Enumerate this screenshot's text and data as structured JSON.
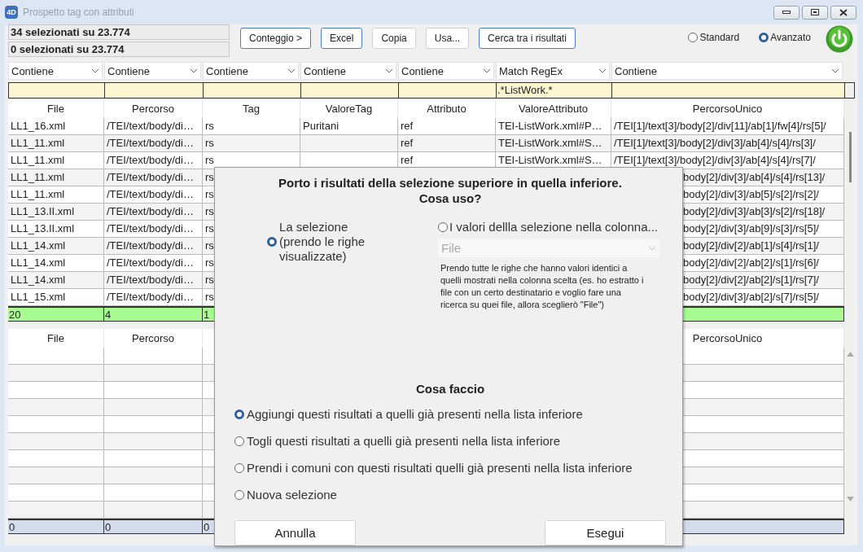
{
  "window": {
    "logo": "4D",
    "title": "Prospetto tag con attributi"
  },
  "counters": [
    "34 selezionati su 23.774",
    "0 selezionati su 23.774"
  ],
  "toolbar_buttons": [
    {
      "label": "Conteggio >",
      "highlighted": true
    },
    {
      "label": "Excel",
      "highlighted": true
    },
    {
      "label": "Copia",
      "highlighted": false
    },
    {
      "label": "Usa...",
      "highlighted": false
    },
    {
      "label": "Cerca tra i risultati",
      "highlighted": true
    }
  ],
  "mode_options": [
    {
      "label": "Standard",
      "selected": false
    },
    {
      "label": "Avanzato",
      "selected": true
    }
  ],
  "filters": [
    {
      "operator": "Contiene"
    },
    {
      "operator": "Contiene"
    },
    {
      "operator": "Contiene"
    },
    {
      "operator": "Contiene"
    },
    {
      "operator": "Contiene"
    },
    {
      "operator": "Match RegEx",
      "value": ".*ListWork.*"
    },
    {
      "operator": "Contiene"
    }
  ],
  "upper_table": {
    "headers": {
      "file": "File",
      "percorso": "Percorso",
      "tag": "Tag",
      "valore_tag": "ValoreTag",
      "attributo": "Attributo",
      "valore_attributo": "ValoreAttributo",
      "percorso_unico": "PercorsoUnico"
    },
    "rows": [
      {
        "file": "LL1_16.xml",
        "percorso": "/TEI/text/body/di…",
        "tag": "rs",
        "valore_tag": "Puritani",
        "attributo": "ref",
        "valore_attributo": "TEI-ListWork.xml#P…",
        "percorso_unico": "/TEI[1]/text[3]/body[2]/div[11]/ab[1]/fw[4]/rs[5]/"
      },
      {
        "file": "LL1_11.xml",
        "percorso": "/TEI/text/body/di…",
        "tag": "rs",
        "attributo": "ref",
        "valore_attributo": "TEI-ListWork.xml#S…",
        "percorso_unico": "/TEI[1]/text[3]/body[2]/div[3]/ab[4]/s[4]/rs[3]/"
      },
      {
        "file": "LL1_11.xml",
        "percorso": "/TEI/text/body/di…",
        "tag": "rs",
        "attributo": "ref",
        "valore_attributo": "TEI-ListWork.xml#S…",
        "percorso_unico": "/TEI[1]/text[3]/body[2]/div[3]/ab[4]/s[4]/rs[7]/"
      },
      {
        "file": "LL1_11.xml",
        "percorso": "/TEI/text/body/di…",
        "tag": "rs",
        "percorso_unico": "body[2]/div[3]/ab[4]/s[4]/rs[13]/"
      },
      {
        "file": "LL1_11.xml",
        "percorso": "/TEI/text/body/di…",
        "tag": "rs",
        "percorso_unico": "body[2]/div[3]/ab[5]/s[2]/rs[2]/"
      },
      {
        "file": "LL1_13.II.xml",
        "percorso": "/TEI/text/body/di…",
        "tag": "rs",
        "percorso_unico": "body[2]/div[3]/ab[3]/s[2]/rs[18]/"
      },
      {
        "file": "LL1_13.II.xml",
        "percorso": "/TEI/text/body/di…",
        "tag": "rs",
        "percorso_unico": "body[2]/div[3]/ab[9]/s[3]/rs[5]/"
      },
      {
        "file": "LL1_14.xml",
        "percorso": "/TEI/text/body/di…",
        "tag": "rs",
        "percorso_unico": "body[2]/div[2]/ab[1]/s[4]/rs[1]/"
      },
      {
        "file": "LL1_14.xml",
        "percorso": "/TEI/text/body/di…",
        "tag": "rs",
        "percorso_unico": "body[2]/div[2]/ab[2]/s[1]/rs[6]/"
      },
      {
        "file": "LL1_14.xml",
        "percorso": "/TEI/text/body/di…",
        "tag": "rs",
        "percorso_unico": "body[2]/div[2]/ab[2]/s[1]/rs[7]/"
      },
      {
        "file": "LL1_15.xml",
        "percorso": "/TEI/text/body/di…",
        "tag": "rs",
        "percorso_unico": "body[2]/div[3]/ab[2]/s[7]/rs[5]/"
      }
    ],
    "totals": {
      "file": "20",
      "percorso": "4",
      "tag": "1"
    }
  },
  "lower_table": {
    "headers": {
      "file": "File",
      "percorso": "Percorso",
      "percorso_unico": "PercorsoUnico"
    },
    "totals": {
      "file": "0",
      "percorso": "0",
      "tag": "0"
    }
  },
  "dialog": {
    "title": "Porto i risultati della selezione superiore in quella inferiore.\nCosa uso?",
    "sources": [
      {
        "label": "La selezione (prendo le righe visualizzate)",
        "selected": true
      },
      {
        "label": "I valori dellla selezione nella colonna...",
        "selected": false,
        "column": "File",
        "note": "Prendo tutte le righe che hanno valori identici a quelli mostrati nella colonna scelta (es. ho estratto i file con un certo destinatario e voglio fare una ricerca su quei file, allora sceglierò \"File\")"
      }
    ],
    "action_heading": "Cosa faccio",
    "actions": [
      {
        "label": "Aggiungi questi risultati a quelli già presenti nella lista inferiore",
        "selected": true
      },
      {
        "label": "Togli questi risultati a quelli già presenti nella lista inferiore",
        "selected": false
      },
      {
        "label": "Prendi i comuni con questi risultati quelli già presenti nella lista inferiore",
        "selected": false
      },
      {
        "label": "Nuova selezione",
        "selected": false
      }
    ],
    "buttons": [
      "Annulla",
      "Esegui"
    ]
  }
}
